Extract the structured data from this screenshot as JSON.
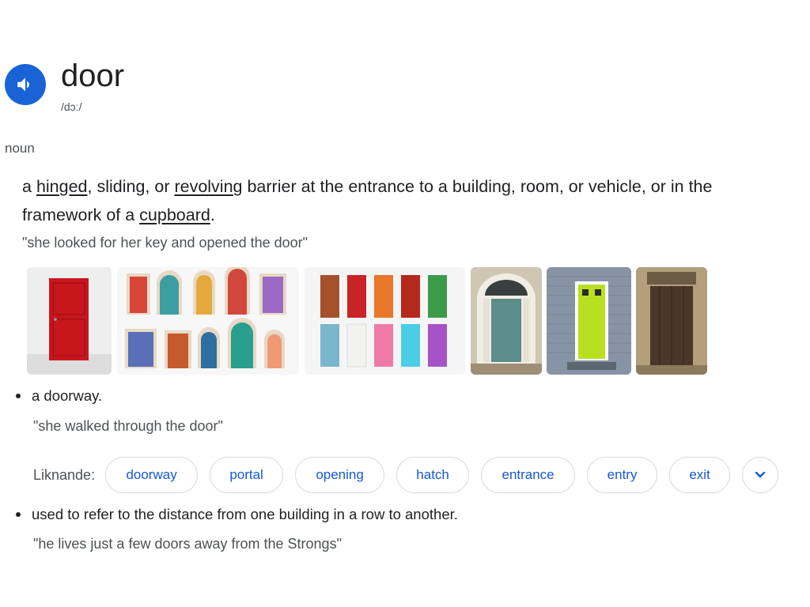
{
  "headword": "door",
  "pronunciation": "/dɔː/",
  "part_of_speech": "noun",
  "definition_main": {
    "t1": "a ",
    "link1": "hinged",
    "t2": ", sliding, or ",
    "link2": "revolving",
    "t3": " barrier at the entrance to a building, room, or vehicle, or in the framework of a ",
    "link3": "cupboard",
    "t4": ".",
    "example": "\"she looked for her key and opened the door\""
  },
  "sense2": {
    "text": "a doorway.",
    "example": "\"she walked through the door\""
  },
  "synonyms": {
    "label": "Liknande:",
    "items": [
      "doorway",
      "portal",
      "opening",
      "hatch",
      "entrance",
      "entry",
      "exit"
    ]
  },
  "sense3": {
    "text": "used to refer to the distance from one building in a row to another.",
    "example": "\"he lives just a few doors away from the Strongs\""
  },
  "icons": {
    "speaker": "speaker-icon",
    "more": "chevron-down-icon"
  },
  "colors": {
    "accent": "#1a63d6",
    "link": "#1558d6",
    "muted_text": "#4d5156"
  }
}
